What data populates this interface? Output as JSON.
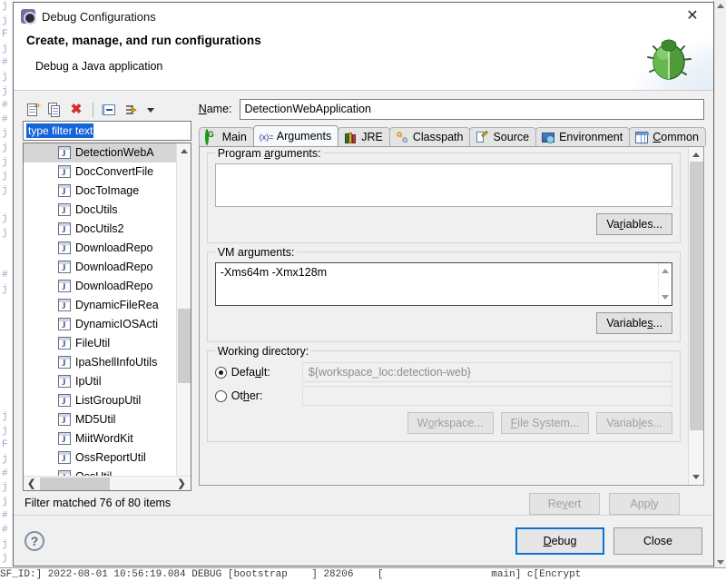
{
  "background": {
    "code_lines": "lv\nj\nF\nj\n#\nj\nj\n#\n#\nj\nj\nj\nj\nj\n\nj\nj\n\n\n#\nj\n",
    "console_line": "SF_ID:] 2022-08-01 10:56:19.084 DEBUG [bootstrap    ] 28206    [                  main] c[Encrypt"
  },
  "titlebar": {
    "title": "Debug Configurations",
    "icon": "debug-config-icon",
    "close": "✕"
  },
  "header": {
    "title": "Create, manage, and run configurations",
    "subtitle": "Debug a Java application",
    "banner_icon": "green-bug-icon"
  },
  "toolbar": {
    "items": [
      {
        "name": "new-configuration-icon",
        "tooltip": "New launch configuration"
      },
      {
        "name": "duplicate-configuration-icon",
        "tooltip": "Duplicate"
      },
      {
        "name": "delete-configuration-icon",
        "tooltip": "Delete"
      },
      {
        "name": "collapse-all-icon",
        "tooltip": "Collapse All"
      },
      {
        "name": "filter-launch-configurations-icon",
        "tooltip": "Filter"
      },
      {
        "name": "view-menu-chevron-icon",
        "tooltip": "View Menu"
      }
    ]
  },
  "filter": {
    "value": "type filter text",
    "placeholder": "type filter text",
    "selected": true
  },
  "tree": {
    "items": [
      {
        "label": "DetectionWebA",
        "selected": true
      },
      {
        "label": "DocConvertFile",
        "selected": false
      },
      {
        "label": "DocToImage",
        "selected": false
      },
      {
        "label": "DocUtils",
        "selected": false
      },
      {
        "label": "DocUtils2",
        "selected": false
      },
      {
        "label": "DownloadRepo",
        "selected": false
      },
      {
        "label": "DownloadRepo",
        "selected": false
      },
      {
        "label": "DownloadRepo",
        "selected": false
      },
      {
        "label": "DynamicFileRea",
        "selected": false
      },
      {
        "label": "DynamicIOSActi",
        "selected": false
      },
      {
        "label": "FileUtil",
        "selected": false
      },
      {
        "label": "IpaShellInfoUtils",
        "selected": false
      },
      {
        "label": "IpUtil",
        "selected": false
      },
      {
        "label": "ListGroupUtil",
        "selected": false
      },
      {
        "label": "MD5Util",
        "selected": false
      },
      {
        "label": "MiitWordKit",
        "selected": false
      },
      {
        "label": "OssReportUtil",
        "selected": false
      },
      {
        "label": "OssUtil",
        "selected": false
      }
    ],
    "hscroll_left": "❮",
    "hscroll_right": "❯",
    "status": "Filter matched 76 of 80 items"
  },
  "name_field": {
    "label_pre": "N",
    "label_underlined": "N",
    "label": "Name:",
    "value": "DetectionWebApplication"
  },
  "tabs": [
    {
      "label": "Main",
      "icon": "main-tab-icon",
      "active": false
    },
    {
      "label": "Arguments",
      "icon": "arguments-tab-icon",
      "active": true
    },
    {
      "label": "JRE",
      "icon": "jre-tab-icon",
      "active": false
    },
    {
      "label": "Classpath",
      "icon": "classpath-tab-icon",
      "active": false
    },
    {
      "label": "Source",
      "icon": "source-tab-icon",
      "active": false
    },
    {
      "label": "Environment",
      "icon": "environment-tab-icon",
      "active": false
    },
    {
      "label": "Common",
      "icon": "common-tab-icon",
      "active": false
    }
  ],
  "program_arguments": {
    "group_title": "Program arguments:",
    "value": "",
    "variables_button": "Variables..."
  },
  "vm_arguments": {
    "group_title": "VM arguments:",
    "value": "-Xms64m -Xmx128m",
    "variables_button": "Variables...",
    "focused": true
  },
  "working_directory": {
    "group_title": "Working directory:",
    "default_label": "Default:",
    "default_value": "${workspace_loc:detection-web}",
    "default_selected": true,
    "other_label": "Other:",
    "other_value": "",
    "other_selected": false,
    "buttons": [
      {
        "label": "Workspace...",
        "disabled": true
      },
      {
        "label": "File System...",
        "disabled": true
      },
      {
        "label": "Variables...",
        "disabled": true
      }
    ]
  },
  "apply_bar": {
    "revert": "Revert",
    "revert_disabled": true,
    "apply": "Apply",
    "apply_disabled": true
  },
  "footer": {
    "help_icon": "?",
    "debug_button": "Debug",
    "close_button": "Close",
    "primary_accent": "#0a74d4"
  }
}
